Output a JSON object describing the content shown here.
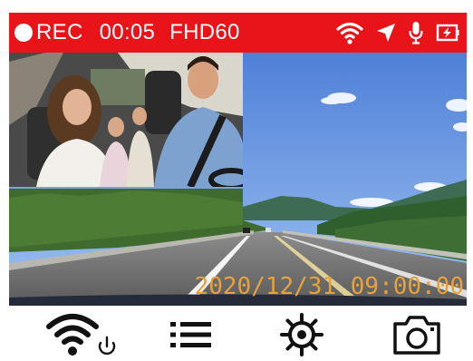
{
  "status_bar": {
    "rec_label": "REC",
    "elapsed": "00:05",
    "resolution": "FHD60",
    "icons": [
      "wifi-icon",
      "gps-arrow-icon",
      "microphone-icon",
      "battery-charging-icon"
    ],
    "background_color": "#e8141a"
  },
  "video": {
    "timestamp": "2020/12/31 09:00:00",
    "timestamp_color": "#e8a23a",
    "main_view": "front-road-camera",
    "pip_view": "cabin-camera"
  },
  "toolbar": {
    "buttons": [
      "wifi-power-icon",
      "menu-list-icon",
      "settings-gear-icon",
      "camera-snapshot-icon"
    ]
  }
}
